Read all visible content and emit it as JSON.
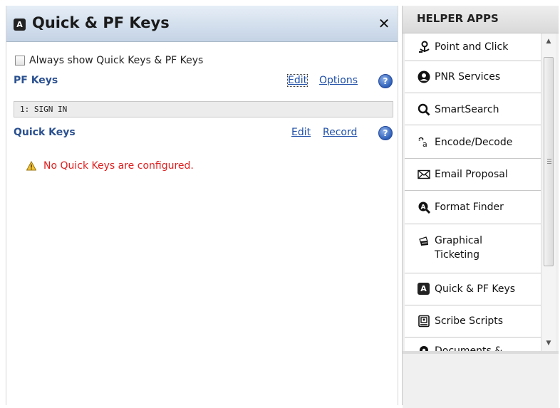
{
  "quick_panel": {
    "badge": "A",
    "title": "Quick & PF Keys",
    "close_label": "✕",
    "always_show_label": "Always show Quick Keys & PF Keys",
    "pf_keys": {
      "title": "PF Keys",
      "edit_label": "Edit",
      "options_label": "Options",
      "help_label": "?",
      "items": [
        "1: SIGN IN"
      ]
    },
    "quick_keys": {
      "title": "Quick Keys",
      "edit_label": "Edit",
      "record_label": "Record",
      "help_label": "?",
      "empty_message": "No Quick Keys are configured."
    }
  },
  "helper_apps": {
    "title": "HELPER APPS",
    "items": [
      {
        "label": "Point and Click",
        "icon": "point-click-icon"
      },
      {
        "label": "PNR Services",
        "icon": "person-icon"
      },
      {
        "label": "SmartSearch",
        "icon": "search-icon"
      },
      {
        "label": "Encode/Decode",
        "icon": "encode-decode-icon"
      },
      {
        "label": "Email Proposal",
        "icon": "envelope-icon"
      },
      {
        "label": "Format Finder",
        "icon": "format-finder-icon"
      },
      {
        "label": "Graphical Ticketing",
        "label_line1": "Graphical",
        "label_line2": "Ticketing",
        "icon": "tickets-icon"
      },
      {
        "label": "Quick & PF Keys",
        "icon": "a-badge-icon",
        "badge": "A"
      },
      {
        "label": "Scribe Scripts",
        "icon": "script-icon"
      },
      {
        "label": "Documents &",
        "icon": "map-pin-icon"
      }
    ]
  },
  "colors": {
    "link": "#1f4fa8",
    "section_title": "#2a5090",
    "warning_text": "#e02020"
  }
}
